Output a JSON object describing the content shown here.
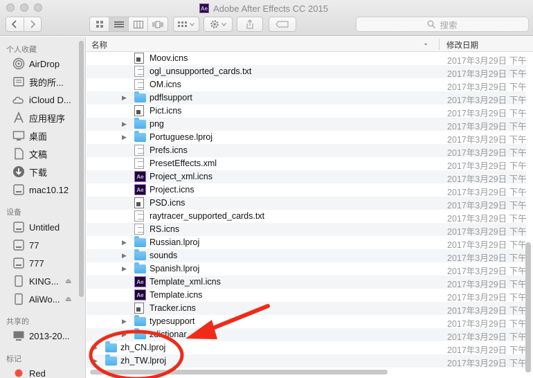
{
  "window": {
    "title": "Adobe After Effects CC 2015",
    "app_badge": "Ae"
  },
  "toolbar": {
    "search_placeholder": "搜索"
  },
  "sidebar": {
    "sections": [
      {
        "header": "个人收藏",
        "items": [
          {
            "label": "AirDrop",
            "icon": "airdrop-icon"
          },
          {
            "label": "我的所...",
            "icon": "documents-icon"
          },
          {
            "label": "iCloud D...",
            "icon": "cloud-icon"
          },
          {
            "label": "应用程序",
            "icon": "applications-icon"
          },
          {
            "label": "桌面",
            "icon": "desktop-icon"
          },
          {
            "label": "文稿",
            "icon": "document-icon"
          },
          {
            "label": "下载",
            "icon": "download-icon"
          },
          {
            "label": "mac10.12",
            "icon": "disk-icon"
          }
        ]
      },
      {
        "header": "设备",
        "items": [
          {
            "label": "Untitled",
            "icon": "disk-icon"
          },
          {
            "label": "77",
            "icon": "disk-icon"
          },
          {
            "label": "777",
            "icon": "disk-icon"
          },
          {
            "label": "KING...",
            "icon": "drive-icon",
            "eject": true
          },
          {
            "label": "AliWo...",
            "icon": "drive-icon",
            "eject": true
          }
        ]
      },
      {
        "header": "共享的",
        "items": [
          {
            "label": "2013-20...",
            "icon": "monitor-icon"
          }
        ]
      },
      {
        "header": "标记",
        "items": [
          {
            "label": "Red",
            "icon": "tag-red-icon"
          }
        ]
      }
    ]
  },
  "columns": {
    "name": "名称",
    "date": "修改日期"
  },
  "files": [
    {
      "name": "Moov.icns",
      "type": "icns",
      "date": "2017年3月29日 下午",
      "indent": 1
    },
    {
      "name": "ogl_unsupported_cards.txt",
      "type": "doc",
      "date": "2017年3月29日 下午",
      "indent": 1
    },
    {
      "name": "OM.icns",
      "type": "doc",
      "date": "2017年3月29日 下午",
      "indent": 1
    },
    {
      "name": "pdflsupport",
      "type": "folder",
      "date": "2017年3月29日 下午",
      "indent": 1,
      "expandable": true
    },
    {
      "name": "Pict.icns",
      "type": "icns",
      "date": "2017年3月29日 下午",
      "indent": 1
    },
    {
      "name": "png",
      "type": "folder",
      "date": "2017年3月29日 下午",
      "indent": 1,
      "expandable": true
    },
    {
      "name": "Portuguese.lproj",
      "type": "folder",
      "date": "2017年3月29日 下午",
      "indent": 1,
      "expandable": true
    },
    {
      "name": "Prefs.icns",
      "type": "doc",
      "date": "2017年3月29日 下午",
      "indent": 1
    },
    {
      "name": "PresetEffects.xml",
      "type": "doc",
      "date": "2017年3月29日 下午",
      "indent": 1
    },
    {
      "name": "Project_xml.icns",
      "type": "ae",
      "date": "2017年3月29日 下午",
      "indent": 1
    },
    {
      "name": "Project.icns",
      "type": "ae",
      "date": "2017年3月29日 下午",
      "indent": 1
    },
    {
      "name": "PSD.icns",
      "type": "icns",
      "date": "2017年3月29日 下午",
      "indent": 1
    },
    {
      "name": "raytracer_supported_cards.txt",
      "type": "doc",
      "date": "2017年3月29日 下午",
      "indent": 1
    },
    {
      "name": "RS.icns",
      "type": "doc",
      "date": "2017年3月29日 下午",
      "indent": 1
    },
    {
      "name": "Russian.lproj",
      "type": "folder",
      "date": "2017年3月29日 下午",
      "indent": 1,
      "expandable": true
    },
    {
      "name": "sounds",
      "type": "folder",
      "date": "2017年3月29日 下午",
      "indent": 1,
      "expandable": true
    },
    {
      "name": "Spanish.lproj",
      "type": "folder",
      "date": "2017年3月29日 下午",
      "indent": 1,
      "expandable": true
    },
    {
      "name": "Template_xml.icns",
      "type": "ae",
      "date": "2017年3月29日 下午",
      "indent": 1
    },
    {
      "name": "Template.icns",
      "type": "ae",
      "date": "2017年3月29日 下午",
      "indent": 1
    },
    {
      "name": "Tracker.icns",
      "type": "icns",
      "date": "2017年3月29日 下午",
      "indent": 1
    },
    {
      "name": "typesupport",
      "type": "folder",
      "date": "2017年3月29日 下午",
      "indent": 1,
      "expandable": true
    },
    {
      "name": "zdictionar",
      "type": "folder",
      "date": "2017年3月29日 下午",
      "indent": 1,
      "expandable": true
    },
    {
      "name": "zh_CN.lproj",
      "type": "folder",
      "date": "2017年3月29日 下午",
      "indent": 0,
      "expandable": true
    },
    {
      "name": "zh_TW.lproj",
      "type": "folder",
      "date": "2017年3月29日 下午",
      "indent": 0,
      "expandable": true
    }
  ],
  "colors": {
    "annotation": "#ee2b1a",
    "folder": "#5ab6ee",
    "tag_red": "#ff4a3d"
  }
}
